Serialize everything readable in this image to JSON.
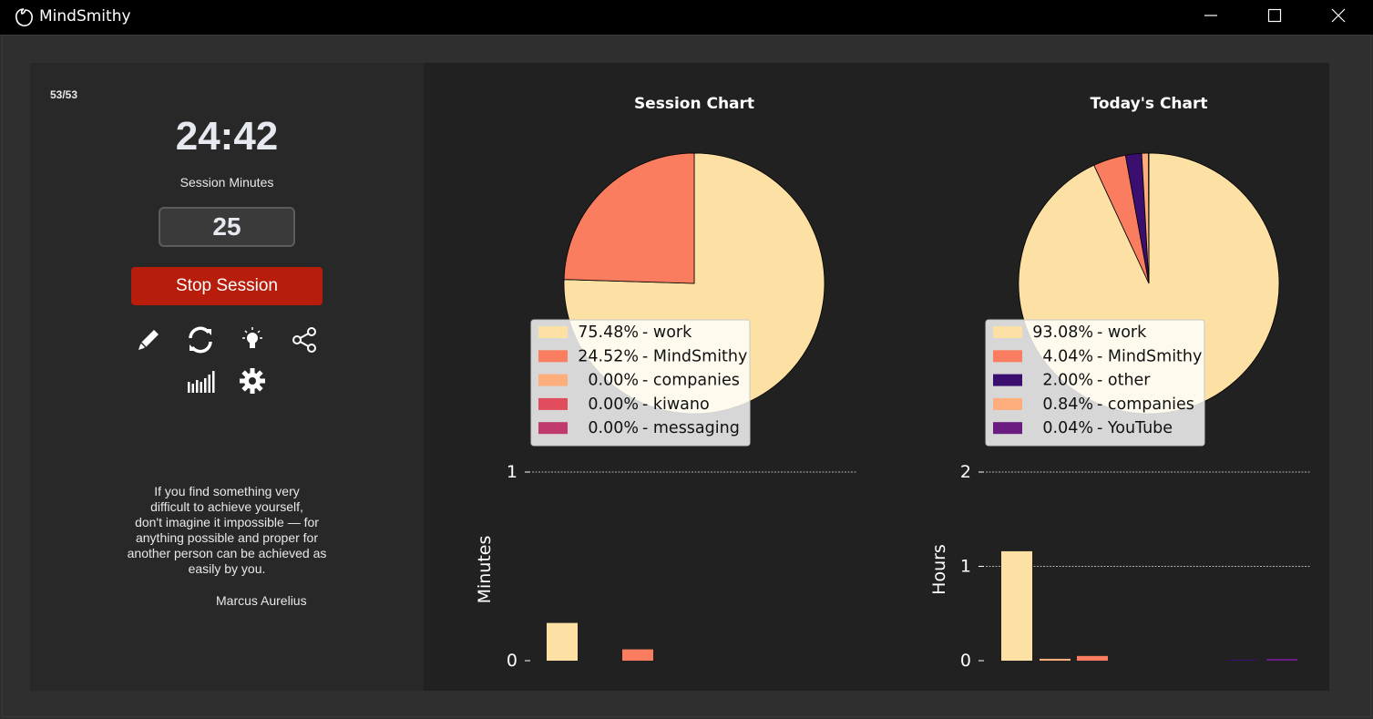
{
  "window": {
    "title": "MindSmithy"
  },
  "left_panel": {
    "counter": "53/53",
    "timer": "24:42",
    "session_minutes_label": "Session Minutes",
    "session_minutes_value": "25",
    "stop_button_label": "Stop Session",
    "icons": [
      "pencil-icon",
      "refresh-icon",
      "lightbulb-icon",
      "share-icon",
      "stats-icon",
      "gear-icon"
    ],
    "quote_lines": [
      "If you find something very",
      "difficult to achieve yourself,",
      "don't imagine it impossible — for",
      "anything possible and proper for",
      "another person can be achieved as",
      "easily by you."
    ],
    "quote_author": "Marcus Aurelius"
  },
  "colors": {
    "accent_stop": "#b81c0a",
    "panel_bg": "#282828",
    "chart_bg": "#212121"
  },
  "chart_data": [
    {
      "type": "pie",
      "title": "Session Chart",
      "legend_entries": [
        "75.48% - work",
        "24.52% - MindSmithy",
        "0.00% - companies",
        "0.00% - kiwano",
        "0.00% - messaging"
      ],
      "categories": [
        "work",
        "MindSmithy",
        "companies",
        "kiwano",
        "messaging"
      ],
      "values": [
        75.48,
        24.52,
        0.0,
        0.0,
        0.0
      ],
      "colors": [
        "#fde0a3",
        "#f97d5e",
        "#fdae7c",
        "#e24d5e",
        "#c03a6e"
      ]
    },
    {
      "type": "bar",
      "ylabel": "Minutes",
      "yticks": [
        "0",
        "1"
      ],
      "ylim": [
        0,
        1
      ],
      "categories": [
        "work",
        "MindSmithy"
      ],
      "values": [
        0.2,
        0.06
      ],
      "colors": [
        "#fde0a3",
        "#f97d5e"
      ],
      "grid": true
    },
    {
      "type": "pie",
      "title": "Today's Chart",
      "legend_entries": [
        "93.08% - work",
        "4.04% - MindSmithy",
        "2.00% - other",
        "0.84% - companies",
        "0.04% - YouTube"
      ],
      "categories": [
        "work",
        "MindSmithy",
        "other",
        "companies",
        "YouTube"
      ],
      "values": [
        93.08,
        4.04,
        2.0,
        0.84,
        0.04
      ],
      "colors": [
        "#fde0a3",
        "#f97d5e",
        "#3b0f70",
        "#fdae7c",
        "#6a1c81"
      ]
    },
    {
      "type": "bar",
      "ylabel": "Hours",
      "yticks": [
        "0",
        "1",
        "2"
      ],
      "ylim": [
        0,
        2
      ],
      "categories": [
        "work",
        "other",
        "MindSmithy",
        "companies",
        "YouTube"
      ],
      "values": [
        1.16,
        0.02,
        0.05,
        0.01,
        0.02
      ],
      "colors": [
        "#fde0a3",
        "#fdae7c",
        "#f97d5e",
        "#3b0f70",
        "#6a1c81"
      ],
      "grid": true
    }
  ]
}
